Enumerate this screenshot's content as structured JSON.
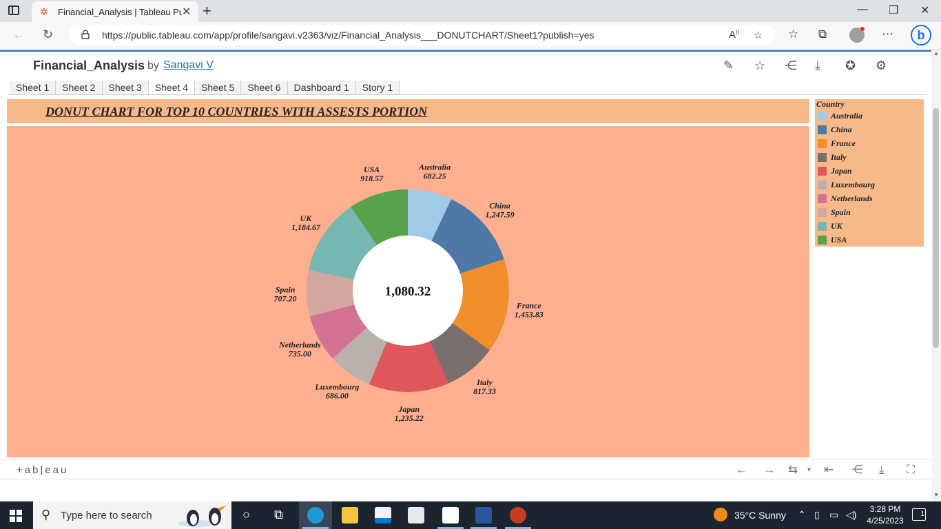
{
  "browser": {
    "tab_title": "Financial_Analysis | Tableau Publi",
    "url": "https://public.tableau.com/app/profile/sangavi.v2363/viz/Financial_Analysis___DONUTCHART/Sheet1?publish=yes",
    "icons": [
      "tab-actions-icon",
      "tableau-favicon-icon",
      "close-icon",
      "new-tab-icon",
      "minimize-icon",
      "maximize-icon",
      "close-window-icon",
      "back-icon",
      "refresh-icon",
      "lock-icon",
      "read-aloud-icon",
      "add-favorite-icon",
      "favorites-icon",
      "collections-icon",
      "profile-icon",
      "more-icon",
      "bing-icon"
    ]
  },
  "viz": {
    "title": "Financial_Analysis",
    "by": "by",
    "author": "Sangavi V",
    "sheet_tabs": [
      "Sheet 1",
      "Sheet 2",
      "Sheet 3",
      "Sheet 4",
      "Sheet 5",
      "Sheet 6",
      "Dashboard 1",
      "Story 1"
    ],
    "active_tab": "Sheet 4",
    "chart_title": "DONUT CHART FOR TOP 10 COUNTRIES WITH ASSESTS PORTION",
    "center_value": "1,080.32",
    "legend_title": "Country",
    "footer_logo": "+ab|eau"
  },
  "chart_data": {
    "type": "pie",
    "variant": "donut",
    "title": "DONUT CHART FOR TOP 10 COUNTRIES WITH ASSESTS PORTION",
    "center_label": "1,080.32",
    "legend": "right",
    "slices": [
      {
        "name": "Australia",
        "value": 682.25,
        "label": "682.25",
        "color": "#a0cbe8"
      },
      {
        "name": "China",
        "value": 1247.59,
        "label": "1,247.59",
        "color": "#4e79a7"
      },
      {
        "name": "France",
        "value": 1453.83,
        "label": "1,453.83",
        "color": "#f28e2b"
      },
      {
        "name": "Italy",
        "value": 817.33,
        "label": "817.33",
        "color": "#79706e"
      },
      {
        "name": "Japan",
        "value": 1235.22,
        "label": "1,235.22",
        "color": "#e15759"
      },
      {
        "name": "Luxembourg",
        "value": 686.0,
        "label": "686.00",
        "color": "#bab0ac"
      },
      {
        "name": "Netherlands",
        "value": 735.0,
        "label": "735.00",
        "color": "#d37295"
      },
      {
        "name": "Spain",
        "value": 707.2,
        "label": "707.20",
        "color": "#d4a6a0"
      },
      {
        "name": "UK",
        "value": 1184.67,
        "label": "1,184.67",
        "color": "#76b7b2"
      },
      {
        "name": "USA",
        "value": 918.57,
        "label": "918.57",
        "color": "#59a14f"
      }
    ]
  },
  "taskbar": {
    "search_placeholder": "Type here to search",
    "weather": "35°C  Sunny",
    "time": "3:28 PM",
    "date": "4/25/2023",
    "notifications": "1",
    "icons": [
      "start-icon",
      "search-icon",
      "cortana-icon",
      "task-view-icon",
      "edge-icon",
      "file-explorer-icon",
      "store-icon",
      "mail-icon",
      "tableau-icon",
      "word-icon",
      "powerpoint-icon",
      "weather-icon",
      "chevron-up-icon",
      "network-icon",
      "battery-icon",
      "volume-icon",
      "notification-icon"
    ]
  }
}
